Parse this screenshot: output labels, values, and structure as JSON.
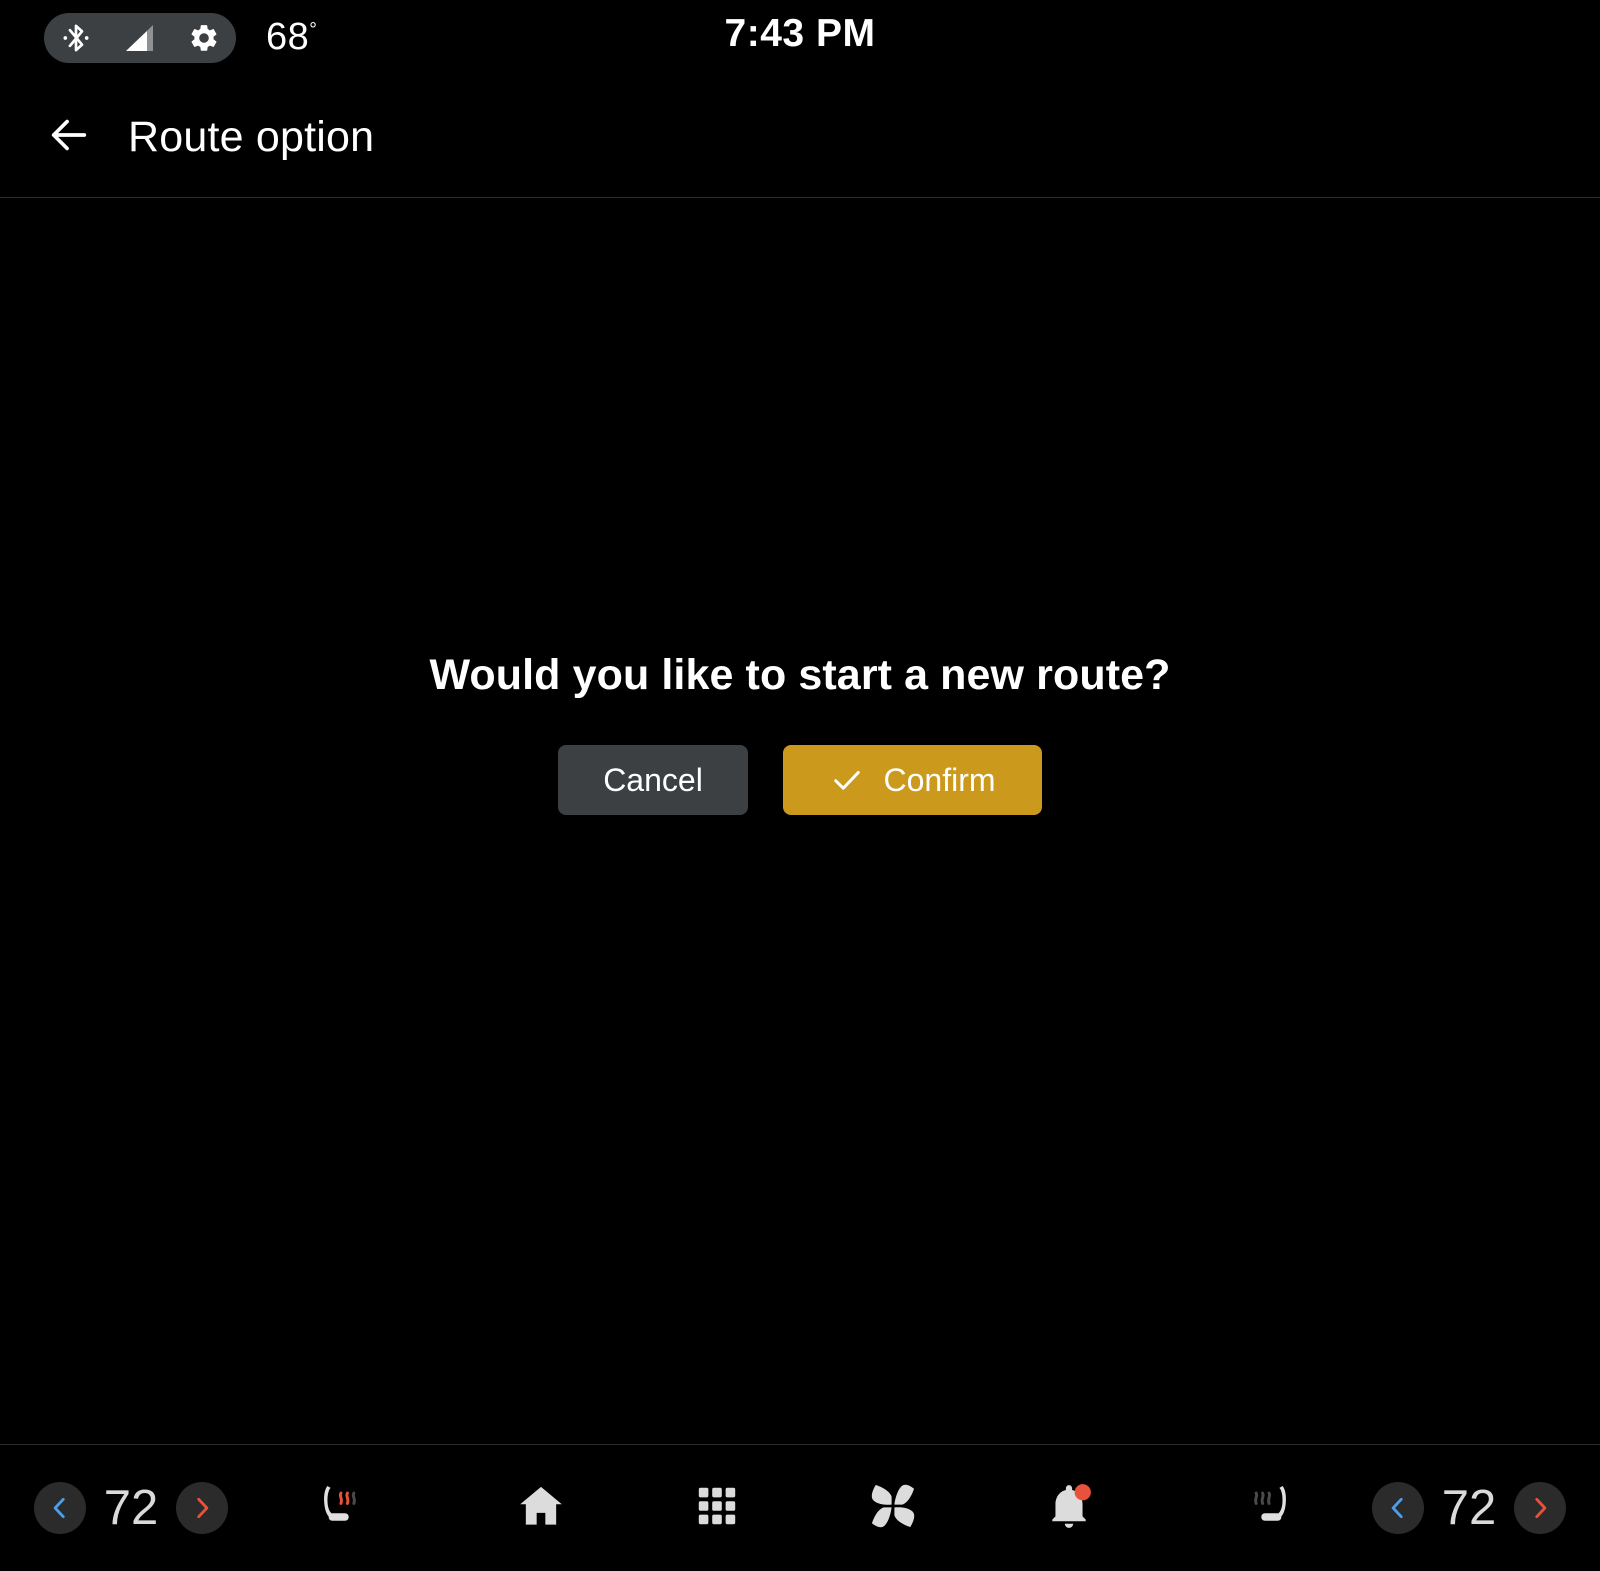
{
  "status_bar": {
    "icons": [
      "bluetooth-icon",
      "cellular-signal-icon",
      "gear-icon"
    ],
    "outside_temp": "68",
    "degree_symbol": "°",
    "clock": "7:43 PM",
    "pill_color": "#3c4043"
  },
  "header": {
    "back_icon": "back-arrow-icon",
    "title": "Route option"
  },
  "dialog": {
    "message": "Would you like to start a new route?",
    "cancel_label": "Cancel",
    "confirm_label": "Confirm",
    "confirm_icon": "check-icon",
    "cancel_color": "#3c4043",
    "confirm_color": "#cb9a1d"
  },
  "nav_bar": {
    "left_climate": {
      "decrease_icon": "chevron-left-icon",
      "temperature": "72",
      "increase_icon": "chevron-right-icon",
      "seat_icon": "heated-seat-driver-icon",
      "seat_active": true
    },
    "right_climate": {
      "seat_icon": "heated-seat-passenger-icon",
      "seat_active": false,
      "decrease_icon": "chevron-left-icon",
      "temperature": "72",
      "increase_icon": "chevron-right-icon"
    },
    "center_items": [
      {
        "icon": "home-icon",
        "name": "home"
      },
      {
        "icon": "apps-grid-icon",
        "name": "apps"
      },
      {
        "icon": "fan-icon",
        "name": "climate"
      },
      {
        "icon": "bell-icon",
        "name": "notifications",
        "badge": true
      }
    ],
    "chevron_cold_color": "#4a9eea",
    "chevron_hot_color": "#e8523a",
    "badge_color": "#e8523a"
  }
}
